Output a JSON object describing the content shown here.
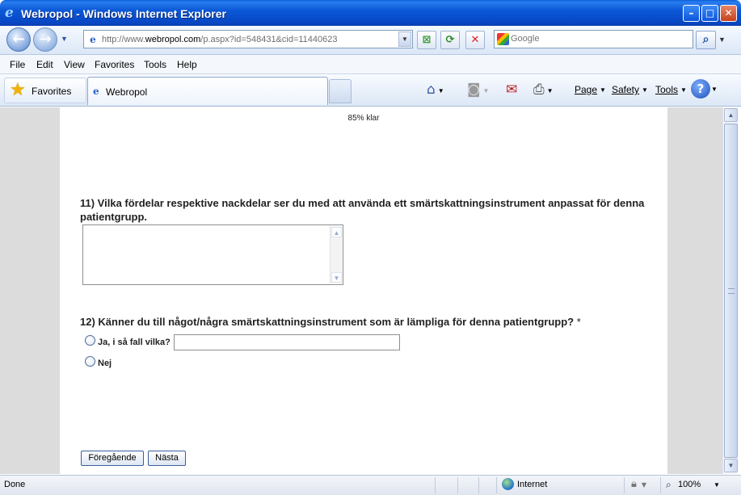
{
  "window": {
    "title": "Webropol - Windows Internet Explorer"
  },
  "address": {
    "url_prefix": "http://www.",
    "url_domain": "webropol.com",
    "url_suffix": "/p.aspx?id=548431&cid=11440623"
  },
  "search": {
    "placeholder": "Google"
  },
  "menu": [
    "File",
    "Edit",
    "View",
    "Favorites",
    "Tools",
    "Help"
  ],
  "favorites": {
    "label": "Favorites"
  },
  "tab": {
    "label": "Webropol"
  },
  "commands": {
    "page": "Page",
    "safety": "Safety",
    "tools": "Tools"
  },
  "survey": {
    "progress": "85% klar",
    "q11": {
      "text": "11) Vilka fördelar respektive nackdelar ser du med att använda ett smärtskattningsinstrument anpassat för denna patientgrupp.",
      "value": ""
    },
    "q12": {
      "text": "12) Känner du till något/några smärtskattningsinstrument som är lämpliga för denna patientgrupp?",
      "required": "*",
      "options": [
        "Ja, i så fall vilka?",
        "Nej"
      ],
      "other_value": ""
    },
    "prev": "Föregående",
    "next": "Nästa"
  },
  "status": {
    "text": "Done",
    "zone": "Internet",
    "zoom": "100%"
  },
  "colors": {
    "titlebar": "#0b58d6",
    "chrome": "#dce7f6"
  }
}
